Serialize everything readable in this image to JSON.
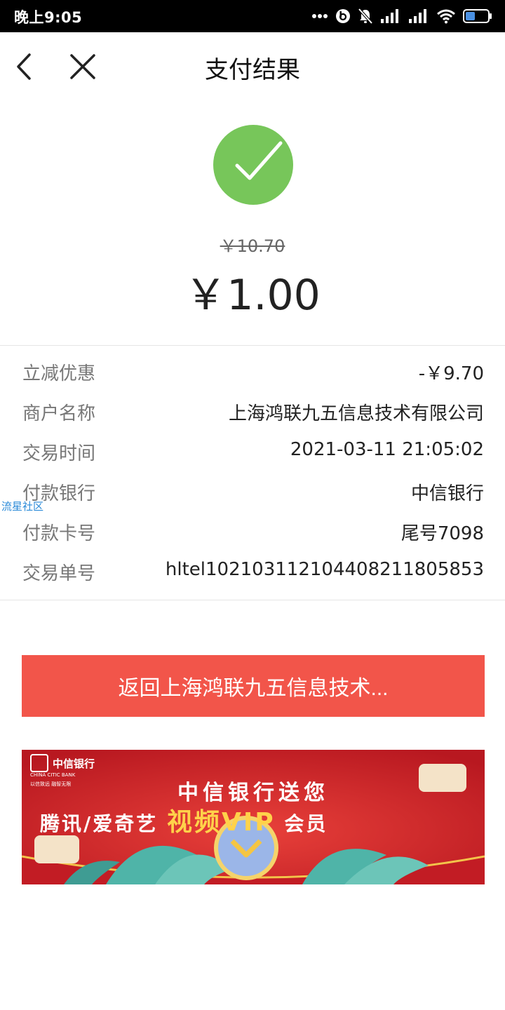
{
  "status_bar": {
    "time": "晚上9:05",
    "icons": [
      "more-dots-icon",
      "beats-icon",
      "mute-bell-icon",
      "signal-icon",
      "signal-icon",
      "wifi-icon",
      "battery-icon"
    ]
  },
  "nav": {
    "title": "支付结果",
    "back_icon": "back-arrow-icon",
    "close_icon": "close-icon"
  },
  "result": {
    "status_icon": "check-circle-icon",
    "status_color": "#77c65a",
    "original_amount": "￥10.70",
    "paid_amount": "￥1.00"
  },
  "details": [
    {
      "label": "立减优惠",
      "value": "-￥9.70"
    },
    {
      "label": "商户名称",
      "value": "上海鸿联九五信息技术有限公司"
    },
    {
      "label": "交易时间",
      "value": "2021-03-11 21:05:02"
    },
    {
      "label": "付款银行",
      "value": "中信银行"
    },
    {
      "label": "付款卡号",
      "value": "尾号7098"
    },
    {
      "label": "交易单号",
      "value": "hltel102103112104408211805853"
    }
  ],
  "watermark": "流星社区",
  "return_button": {
    "label": "返回上海鸿联九五信息技术...",
    "color": "#f2554a"
  },
  "banner": {
    "bank_name": "中信银行",
    "bank_name_en": "CHINA CITIC BANK",
    "slogan": "以信致远 融智无限",
    "line1": "中信银行送您",
    "line2_prefix": "腾讯/爱奇艺",
    "line2_highlight": "视频VIP",
    "line2_suffix": "会员",
    "background_color": "#d0232a"
  }
}
